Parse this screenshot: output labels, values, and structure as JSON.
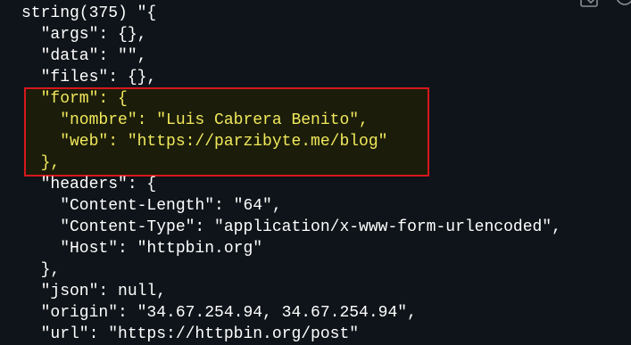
{
  "console": {
    "top_fragment": "  \"   \"   \"   \"",
    "lines": [
      "string(375) \"{",
      "  \"args\": {},",
      "  \"data\": \"\",",
      "  \"files\": {},",
      "  \"form\": {",
      "    \"nombre\": \"Luis Cabrera Benito\",",
      "    \"web\": \"https://parzibyte.me/blog\"",
      "  },",
      "  \"headers\": {",
      "    \"Content-Length\": \"64\",",
      "    \"Content-Type\": \"application/x-www-form-urlencoded\",",
      "    \"Host\": \"httpbin.org\"",
      "  },",
      "  \"json\": null,",
      "  \"origin\": \"34.67.254.94, 34.67.254.94\",",
      "  \"url\": \"https://httpbin.org/post\""
    ]
  },
  "colors": {
    "background": "#0e1419",
    "text": "#ffffff",
    "highlight_text": "#f1e85c",
    "highlight_border": "#d6171d",
    "highlight_fill": "#1b1d0a"
  },
  "icons": {
    "copy": "copy-icon",
    "side": "circle-icon"
  }
}
